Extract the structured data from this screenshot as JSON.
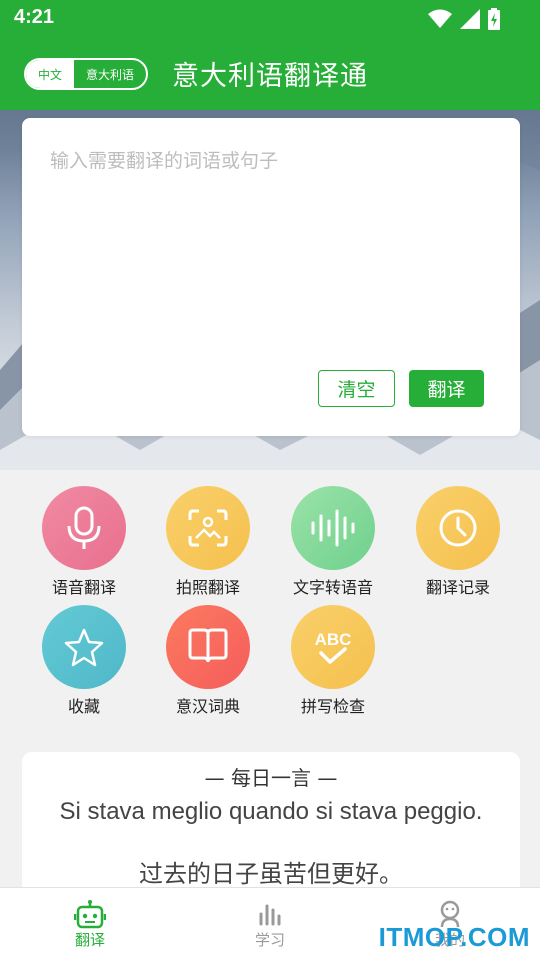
{
  "status_bar": {
    "time": "4:21"
  },
  "header": {
    "lang_source": "中文",
    "lang_target": "意大利语",
    "title": "意大利语翻译通"
  },
  "input": {
    "placeholder": "输入需要翻译的词语或句子",
    "value": "",
    "clear_label": "清空",
    "translate_label": "翻译"
  },
  "features": [
    {
      "label": "语音翻译",
      "icon": "microphone-icon",
      "color": "#ee7f9b"
    },
    {
      "label": "拍照翻译",
      "icon": "photo-scan-icon",
      "color": "#f7c960"
    },
    {
      "label": "文字转语音",
      "icon": "soundwave-icon",
      "color": "#86d99b"
    },
    {
      "label": "翻译记录",
      "icon": "clock-icon",
      "color": "#f8c95e"
    },
    {
      "label": "收藏",
      "icon": "star-icon",
      "color": "#57c2cf"
    },
    {
      "label": "意汉词典",
      "icon": "book-icon",
      "color": "#f86c5c"
    },
    {
      "label": "拼写检查",
      "icon": "abc-check-icon",
      "color": "#f8c95e"
    }
  ],
  "daily": {
    "title": "— 每日一言 —",
    "italian": "Si stava meglio quando si stava peggio.",
    "chinese": "过去的日子虽苦但更好。"
  },
  "bottom_nav": [
    {
      "label": "翻译",
      "icon": "robot-icon",
      "active": true
    },
    {
      "label": "学习",
      "icon": "bars-icon",
      "active": false
    },
    {
      "label": "我的",
      "icon": "user-icon",
      "active": false
    }
  ],
  "watermark": "ITMOP.COM",
  "colors": {
    "primary": "#27ae39",
    "watermark": "#1a9ad6"
  }
}
